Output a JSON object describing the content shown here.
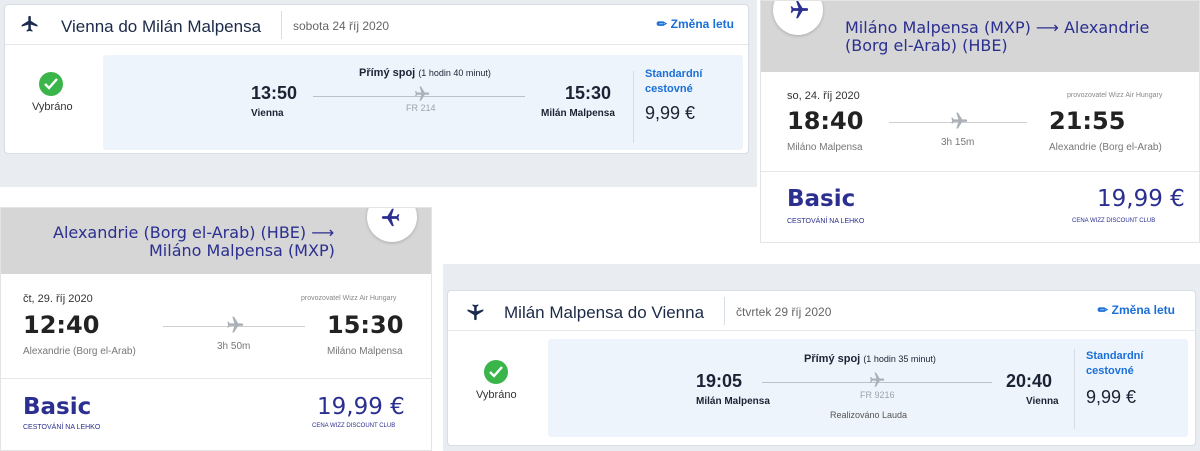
{
  "colors": {
    "ryanair_blue": "#1a6fd8",
    "ryanair_navy": "#1b2a47",
    "check_green": "#3ab54a",
    "wizz_navy": "#2b2f8f",
    "wizz_header_grey": "#d6d6d6"
  },
  "card1": {
    "icon": "plane-icon",
    "route": "Vienna do Milán Malpensa",
    "date": "sobota 24 říj 2020",
    "change_label": "Změna letu",
    "selected_label": "Vybráno",
    "direct_label": "Přímý spoj",
    "duration": "(1 hodin 40 minut)",
    "dep_time": "13:50",
    "dep_city": "Vienna",
    "arr_time": "15:30",
    "arr_city": "Milán Malpensa",
    "flight_no": "FR 214",
    "fare_name": "Standardní cestovné",
    "price": "9,99 €"
  },
  "card2": {
    "title_line1": "Miláno Malpensa (MXP) ⟶ Alexandrie",
    "title_line2": "(Borg el-Arab) (HBE)",
    "date": "so, 24. říj 2020",
    "operator": "provozovatel Wizz Air Hungary",
    "dep_time": "18:40",
    "dep_city": "Miláno Malpensa",
    "duration": "3h 15m",
    "arr_time": "21:55",
    "arr_city": "Alexandrie (Borg el-Arab)",
    "fare_name": "Basic",
    "fare_sub": "CESTOVÁNÍ NA LEHKO",
    "price": "19,99 €",
    "club_label": "CENA WIZZ DISCOUNT CLUB"
  },
  "card3": {
    "title_line1": "Alexandrie (Borg el-Arab) (HBE) ⟶",
    "title_line2": "Miláno Malpensa (MXP)",
    "date": "čt, 29. říj 2020",
    "operator": "provozovatel Wizz Air Hungary",
    "dep_time": "12:40",
    "dep_city": "Alexandrie (Borg el-Arab)",
    "duration": "3h 50m",
    "arr_time": "15:30",
    "arr_city": "Miláno Malpensa",
    "fare_name": "Basic",
    "fare_sub": "CESTOVÁNÍ NA LEHKO",
    "price": "19,99 €",
    "club_label": "CENA WIZZ DISCOUNT CLUB"
  },
  "card4": {
    "icon": "plane-icon",
    "route": "Milán Malpensa do Vienna",
    "date": "čtvrtek 29 říj 2020",
    "change_label": "Změna letu",
    "selected_label": "Vybráno",
    "direct_label": "Přímý spoj",
    "duration": "(1 hodin 35 minut)",
    "dep_time": "19:05",
    "dep_city": "Milán Malpensa",
    "arr_time": "20:40",
    "arr_city": "Vienna",
    "flight_no": "FR 9216",
    "operated_by": "Realizováno Lauda",
    "fare_name": "Standardní cestovné",
    "price": "9,99 €"
  }
}
